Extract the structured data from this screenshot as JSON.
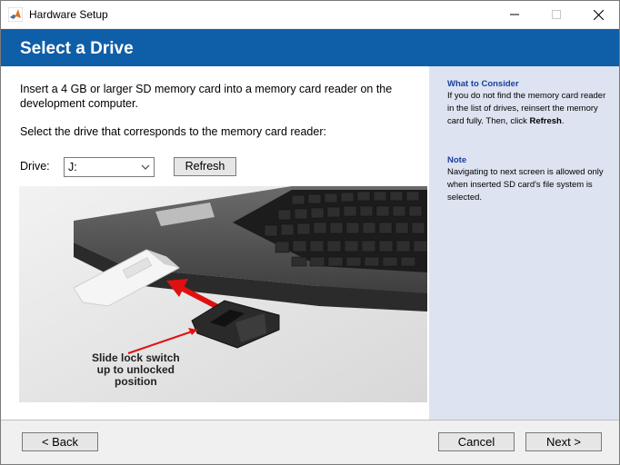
{
  "window": {
    "title": "Hardware Setup"
  },
  "header": {
    "title": "Select a Drive"
  },
  "main": {
    "instruction": "Insert a 4 GB or larger SD memory card into a memory card reader on the development computer.",
    "select_prompt": "Select the drive that corresponds to the memory card reader:",
    "drive_label": "Drive:",
    "drive_value": "J:",
    "refresh_label": "Refresh",
    "image_caption": [
      "Slide lock switch",
      "up to unlocked",
      "position"
    ]
  },
  "sidebar": {
    "consider_heading": "What to Consider",
    "consider_text_1": "If you do not find the memory card reader in the list of drives, reinsert the memory card fully. Then, click ",
    "consider_text_bold": "Refresh",
    "consider_text_2": ".",
    "note_heading": "Note",
    "note_text": "Navigating to next screen is allowed only when inserted SD card's file system is selected."
  },
  "footer": {
    "back_label": "< Back",
    "cancel_label": "Cancel",
    "next_label": "Next >"
  },
  "colors": {
    "header": "#0f5ea8",
    "sidebar": "#dde3f0",
    "heading_blue": "#1a3fa0",
    "arrow_red": "#e01010"
  }
}
